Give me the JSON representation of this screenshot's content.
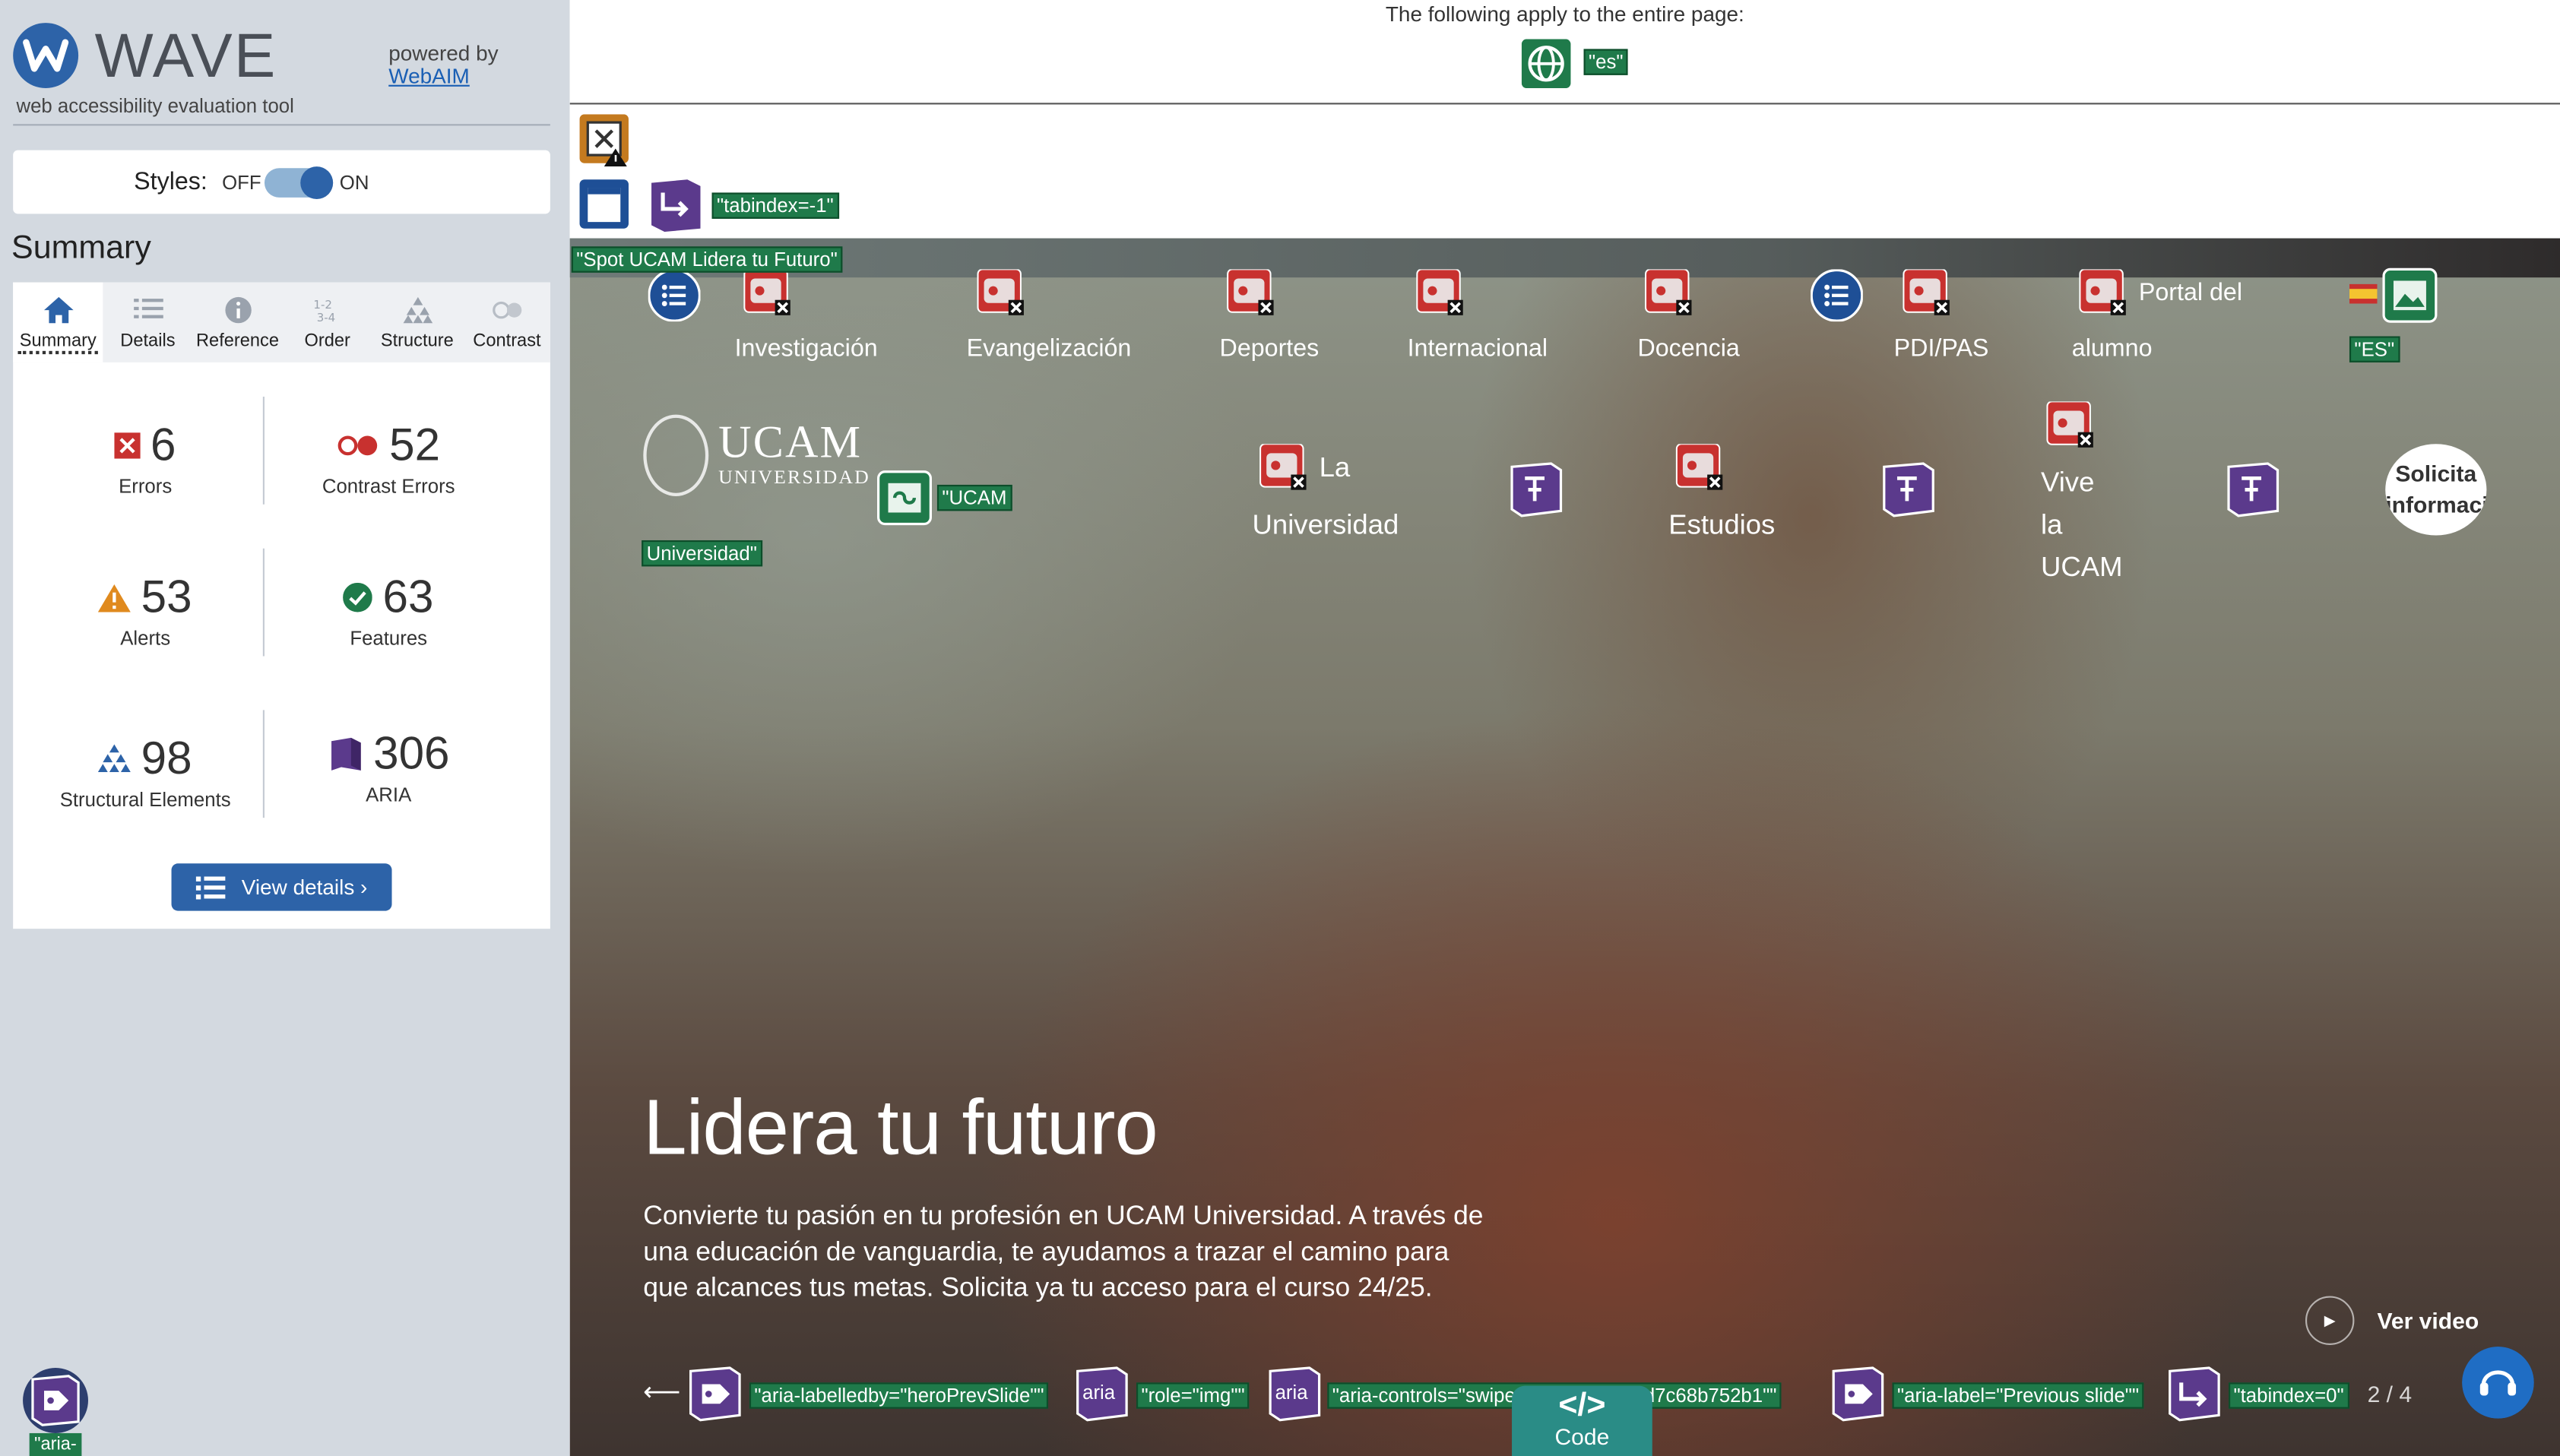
{
  "wave": {
    "title": "WAVE",
    "subtitle": "web accessibility evaluation tool",
    "powered_by": "powered by",
    "webaim_link": "WebAIM",
    "styles_label": "Styles:",
    "styles_off": "OFF",
    "styles_on": "ON",
    "styles_state": "on",
    "summary_heading": "Summary",
    "tabs": [
      {
        "label": "Summary",
        "icon": "home-icon",
        "active": true
      },
      {
        "label": "Details",
        "icon": "list-icon"
      },
      {
        "label": "Reference",
        "icon": "info-icon"
      },
      {
        "label": "Order",
        "icon": "order-icon"
      },
      {
        "label": "Structure",
        "icon": "structure-icon"
      },
      {
        "label": "Contrast",
        "icon": "contrast-icon"
      }
    ],
    "stats": {
      "errors": {
        "value": "6",
        "label": "Errors"
      },
      "contrast": {
        "value": "52",
        "label": "Contrast Errors"
      },
      "alerts": {
        "value": "53",
        "label": "Alerts"
      },
      "features": {
        "value": "63",
        "label": "Features"
      },
      "structural": {
        "value": "98",
        "label": "Structural Elements"
      },
      "aria": {
        "value": "306",
        "label": "ARIA"
      }
    },
    "view_details": "View details ›",
    "sidebar_aria_tag": "\"aria-"
  },
  "page": {
    "note": "The following apply to the entire page:",
    "lang_tag": "\"es\"",
    "tabindex_tag": "\"tabindex=-1\"",
    "spot_tag": "\"Spot UCAM Lidera tu Futuro\"",
    "es_tag": "\"ES\"",
    "ucam_tag1": "\"UCAM",
    "ucam_tag2": "Universidad\"",
    "ucam_logo": {
      "name": "UCAM",
      "sub": "UNIVERSIDAD"
    },
    "nav_top": [
      "Investigación",
      "Evangelización",
      "Deportes",
      "Internacional",
      "Docencia",
      "PDI/PAS"
    ],
    "portal_line1": "Portal del",
    "portal_line2": "alumno",
    "nav_main": {
      "la": "La",
      "universidad": "Universidad",
      "estudios": "Estudios",
      "vive1": "Vive",
      "vive2": "la",
      "vive3": "UCAM"
    },
    "solicita": "Solicita información",
    "hero_title": "Lidera tu futuro",
    "hero_text": "Convierte tu pasión en tu profesión en UCAM Universidad. A través de una educación de vanguardia, te ayudamos a trazar el camino para que alcances tus metas. Solicita ya tu acceso para el curso 24/25.",
    "ver_video": "Ver video",
    "pager": "2 / 4",
    "code_label": "Code",
    "code_symbol": "</>",
    "bottom_tags": {
      "labelledby": "\"aria-labelledby=\"heroPrevSlide\"\"",
      "aria1": "aria",
      "role": "\"role=\"img\"\"",
      "aria2": "aria",
      "controls": "\"aria-controls=\"swiper-w……r-4f38bd7c68b752b1\"\"",
      "label": "\"aria-label=\"Previous slide\"\"",
      "tabindex": "\"tabindex=0\""
    }
  },
  "colors": {
    "wave_blue": "#2d63a8",
    "sidebar_bg": "#d3d9e0",
    "error_red": "#c8312f",
    "feature_green": "#1f7a4a",
    "aria_purple": "#5b3a8c",
    "structure_blue": "#1e4f96"
  }
}
